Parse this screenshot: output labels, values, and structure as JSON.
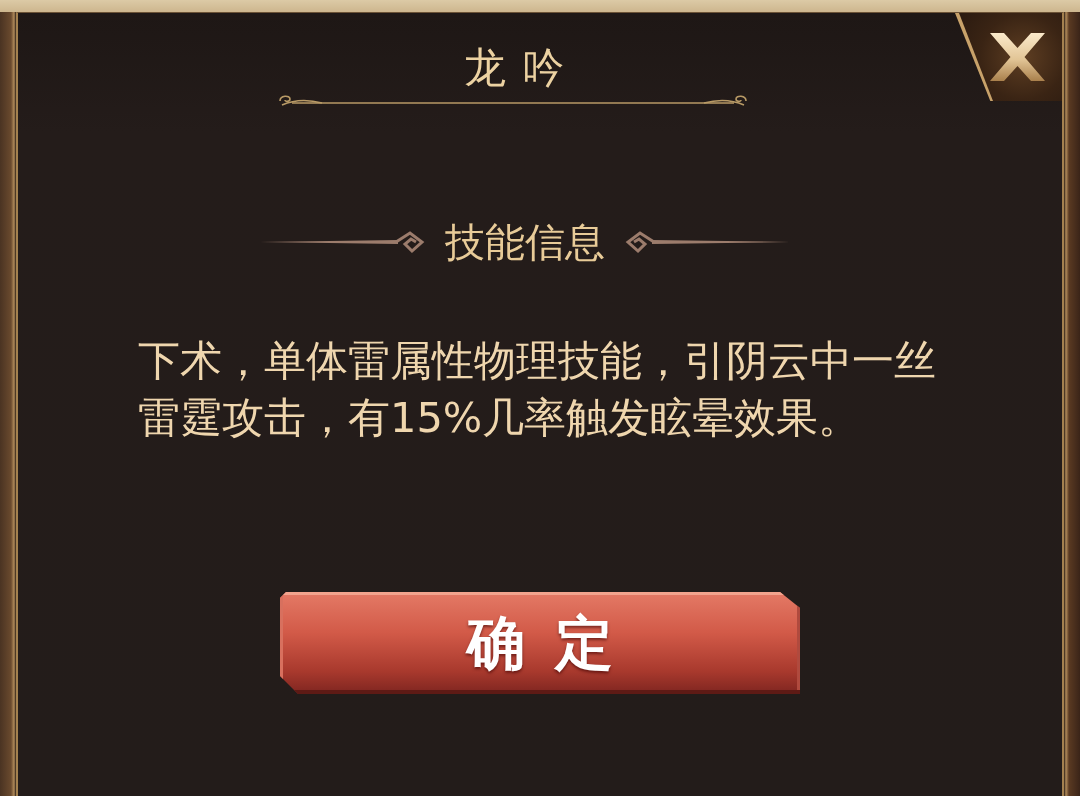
{
  "dialog": {
    "title": "龙吟",
    "section_heading": "技能信息",
    "description": "下术，单体雷属性物理技能，引阴云中一丝雷霆攻击，有15%几率触发眩晕效果。",
    "confirm_button": {
      "label": "确定"
    }
  }
}
